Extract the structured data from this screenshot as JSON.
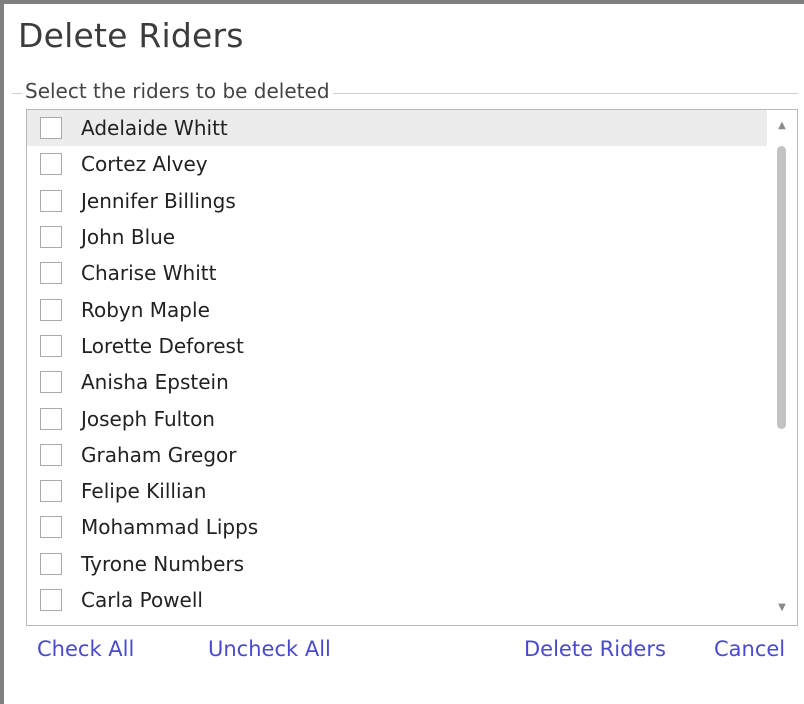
{
  "dialog": {
    "title": "Delete Riders",
    "group_caption": "Select the riders to be deleted"
  },
  "riders": [
    "Adelaide Whitt",
    "Cortez Alvey",
    "Jennifer Billings",
    "John Blue",
    "Charise Whitt",
    "Robyn Maple",
    "Lorette Deforest",
    "Anisha Epstein",
    "Joseph Fulton",
    "Graham Gregor",
    "Felipe Killian",
    "Mohammad Lipps",
    "Tyrone Numbers",
    "Carla Powell"
  ],
  "actions": {
    "check_all": "Check All",
    "uncheck_all": "Uncheck All",
    "delete_riders": "Delete Riders",
    "cancel": "Cancel"
  },
  "colors": {
    "link": "#4a4acc",
    "selected_row": "#ececec",
    "frame_border": "#7f7f7f"
  },
  "icons": {
    "scroll_up": "triangle-up",
    "scroll_down": "triangle-down"
  }
}
